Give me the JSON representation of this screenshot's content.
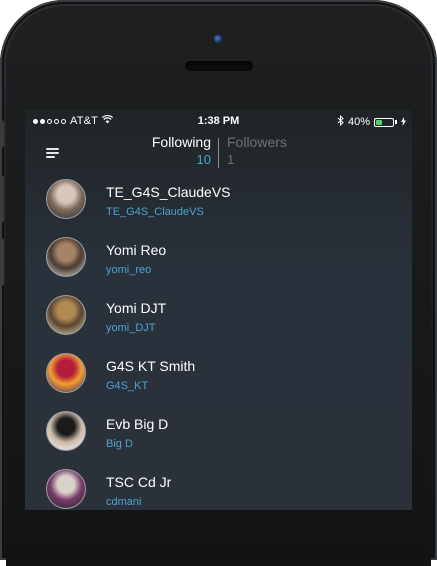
{
  "status_bar": {
    "carrier": "AT&T",
    "time": "1:38 PM",
    "battery": "40%",
    "battery_level": 0.4,
    "signal_dots_filled": 2,
    "signal_dots_total": 5
  },
  "nav": {
    "tabs": [
      {
        "label": "Following",
        "count": "10",
        "active": true
      },
      {
        "label": "Followers",
        "count": "1",
        "active": false
      }
    ]
  },
  "users": [
    {
      "name": "TE_G4S_ClaudeVS",
      "handle": "TE_G4S_ClaudeVS",
      "avatar_colors": [
        "#d8c7b8",
        "#7c6a5c",
        "#2b2a29"
      ]
    },
    {
      "name": "Yomi Reo",
      "handle": "yomi_reo",
      "avatar_colors": [
        "#a58466",
        "#4a3b31",
        "#e6e1d8"
      ]
    },
    {
      "name": "Yomi DJT",
      "handle": "yomi_DJT",
      "avatar_colors": [
        "#b08a52",
        "#5a4630",
        "#e8d9b8"
      ]
    },
    {
      "name": "G4S KT Smith",
      "handle": "G4S_KT",
      "avatar_colors": [
        "#b31d3a",
        "#f0a030",
        "#3a1a5a"
      ]
    },
    {
      "name": "Evb Big D",
      "handle": "Big D",
      "avatar_colors": [
        "#1a1a1a",
        "#c9b9a8",
        "#ffffff"
      ]
    },
    {
      "name": "TSC Cd Jr",
      "handle": "cdmani",
      "avatar_colors": [
        "#d9d2c8",
        "#7a3a6a",
        "#222222"
      ]
    }
  ],
  "colors": {
    "accent": "#4aa6d6",
    "battery": "#4cd964",
    "camera": "#3b7bd4"
  }
}
